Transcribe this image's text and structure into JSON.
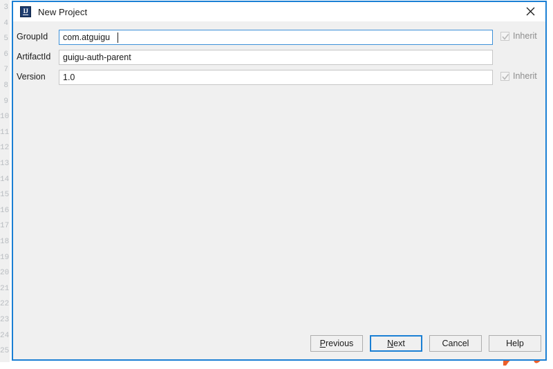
{
  "background": {
    "gutter_line_numbers": [
      "3",
      "4",
      "5",
      "6",
      "7",
      "8",
      "9",
      "10",
      "11",
      "12",
      "13",
      "14",
      "15",
      "16",
      "17",
      "18",
      "19",
      "20",
      "21",
      "22",
      "23",
      "24",
      "25"
    ],
    "editor_background_color": "#ffffff",
    "gutter_background_color": "#f0f0f0"
  },
  "annotation": {
    "name": "orange-hand-drawn-stroke",
    "color": "#ed5f2a"
  },
  "dialog": {
    "title": "New Project",
    "icon": "intellij-idea-icon",
    "close_label": "close-icon",
    "border_color": "#1a7fd4",
    "background_color": "#f0f0f0",
    "titlebar_background_color": "#ffffff",
    "fields": [
      {
        "label": "GroupId",
        "value": "com.atguigu",
        "placeholder": "",
        "focused": true,
        "has_inherit": true,
        "inherit_label": "Inherit",
        "inherit_checked": true,
        "inherit_enabled": false
      },
      {
        "label": "ArtifactId",
        "value": "guigu-auth-parent",
        "placeholder": "",
        "focused": false,
        "has_inherit": false,
        "inherit_label": "",
        "inherit_checked": false,
        "inherit_enabled": false
      },
      {
        "label": "Version",
        "value": "1.0",
        "placeholder": "",
        "focused": false,
        "has_inherit": true,
        "inherit_label": "Inherit",
        "inherit_checked": true,
        "inherit_enabled": false
      }
    ],
    "buttons": [
      {
        "label": "Previous",
        "mnemonic": "P",
        "default": false
      },
      {
        "label": "Next",
        "mnemonic": "N",
        "default": true
      },
      {
        "label": "Cancel",
        "mnemonic": "",
        "default": false
      },
      {
        "label": "Help",
        "mnemonic": "",
        "default": false
      }
    ]
  }
}
